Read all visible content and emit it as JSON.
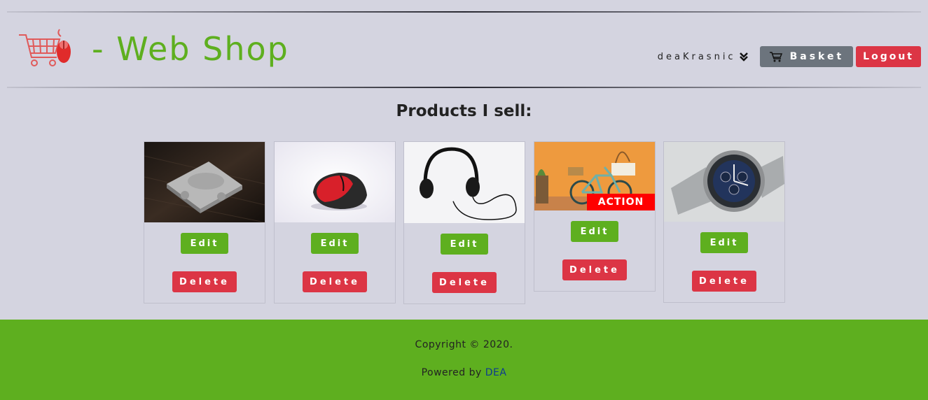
{
  "header": {
    "title": "- Web Shop",
    "logo_icon": "shopping-cart-mouse-icon",
    "username": "deaKrasnic",
    "basket_label": "Basket",
    "logout_label": "Logout",
    "brand_color": "#5eaf1f",
    "danger_color": "#dc3545"
  },
  "main": {
    "title": "Products I sell:",
    "products": [
      {
        "image": "game-console-photo",
        "edit_label": "Edit",
        "delete_label": "Delete"
      },
      {
        "image": "computer-mouse-photo",
        "edit_label": "Edit",
        "delete_label": "Delete"
      },
      {
        "image": "headphones-photo",
        "edit_label": "Edit",
        "delete_label": "Delete"
      },
      {
        "image": "bicycle-photo",
        "badge": "ACTION",
        "edit_label": "Edit",
        "delete_label": "Delete"
      },
      {
        "image": "wristwatch-photo",
        "edit_label": "Edit",
        "delete_label": "Delete"
      }
    ]
  },
  "footer": {
    "copyright": "Copyright © 2020.",
    "powered_prefix": "Powered by ",
    "powered_link": "DEA"
  }
}
